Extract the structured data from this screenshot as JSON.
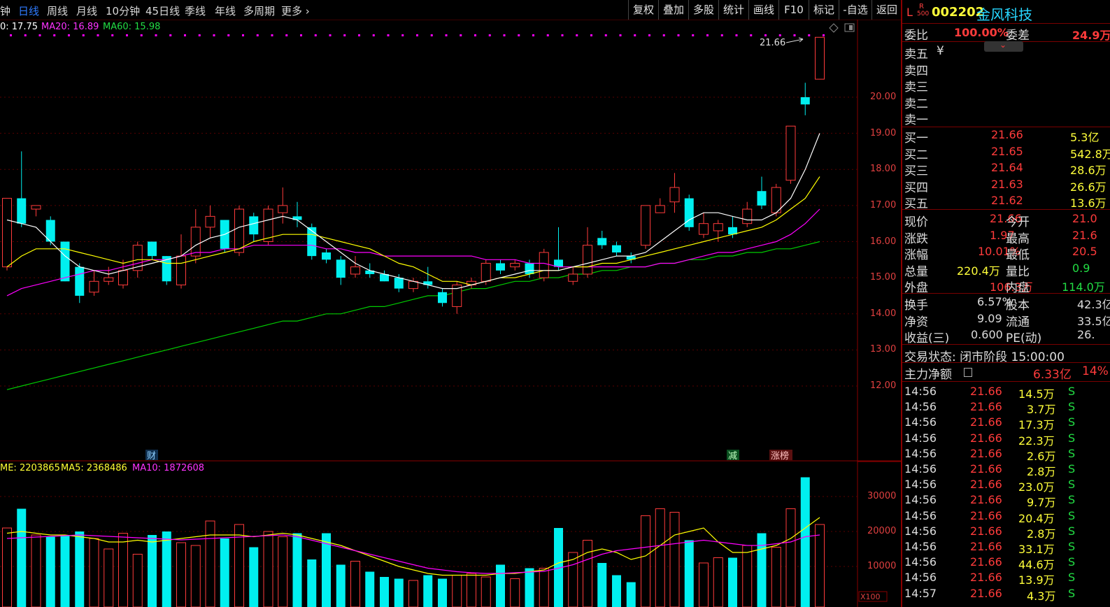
{
  "periods": [
    "钟",
    "日线",
    "周线",
    "月线",
    "10分钟",
    "45日线",
    "季线",
    "年线",
    "多周期",
    "更多"
  ],
  "active_period": "日线",
  "more_chevron": "›",
  "tools": [
    "复权",
    "叠加",
    "多股",
    "统计",
    "画线",
    "F10",
    "标记",
    "-自选",
    "返回"
  ],
  "ma_legend": {
    "ma10": "0: 17.75",
    "ma20": "MA20: 16.89",
    "ma60": "MA60: 15.98"
  },
  "vol_legend": {
    "vol": "ME: 2203865",
    "ma5": "MA5: 2368486",
    "ma10": "MA10: 1872608"
  },
  "price_ticks": [
    "20.00",
    "19.00",
    "18.00",
    "17.00",
    "16.00",
    "15.00",
    "14.00",
    "13.00",
    "12.00"
  ],
  "vol_ticks": [
    "30000",
    "20000",
    "10000"
  ],
  "vol_unit": "X100",
  "high_label": "21.66",
  "markers": {
    "cai": "财",
    "jian": "减",
    "zhangbang": "涨榜"
  },
  "colors": {
    "up": "#ff3b3b",
    "down": "#00f0f0",
    "ma10": "#ffffff",
    "ma20": "#ffff00",
    "ma60": "#ff00ff",
    "ma120": "#00cc00"
  },
  "stock": {
    "flag": "L",
    "r_top": "R",
    "r_bottom": "500",
    "code": "002202",
    "name": "金风科技"
  },
  "weibi": {
    "label": "委比",
    "value": "100.00%",
    "label2": "委差",
    "value2": "24.9万"
  },
  "sell": [
    {
      "label": "卖五",
      "extra": "¥"
    },
    {
      "label": "卖四",
      "extra": ""
    },
    {
      "label": "卖三",
      "extra": ""
    },
    {
      "label": "卖二",
      "extra": ""
    },
    {
      "label": "卖一",
      "extra": ""
    }
  ],
  "buy": [
    {
      "label": "买一",
      "price": "21.66",
      "vol": "5.3亿"
    },
    {
      "label": "买二",
      "price": "21.65",
      "vol": "542.8万"
    },
    {
      "label": "买三",
      "price": "21.64",
      "vol": "28.6万"
    },
    {
      "label": "买四",
      "price": "21.63",
      "vol": "26.6万"
    },
    {
      "label": "买五",
      "price": "21.62",
      "vol": "13.6万"
    }
  ],
  "quote": [
    {
      "l1": "现价",
      "v1": "21.66",
      "l2": "今开",
      "v2": "21.0"
    },
    {
      "l1": "涨跌",
      "v1": "1.97",
      "l2": "最高",
      "v2": "21.6"
    },
    {
      "l1": "涨幅",
      "v1": "10.01%",
      "l2": "最低",
      "v2": "20.5"
    },
    {
      "l1": "总量",
      "v1": "220.4万",
      "l2": "量比",
      "v2": "0.9"
    },
    {
      "l1": "外盘",
      "v1": "106.3万",
      "l2": "内盘",
      "v2": "114.0万"
    }
  ],
  "info": [
    {
      "l1": "换手",
      "v1": "6.57%",
      "l2": "股本",
      "v2": "42.3亿"
    },
    {
      "l1": "净资",
      "v1": "9.09",
      "l2": "流通",
      "v2": "33.5亿"
    },
    {
      "l1": "收益(三)",
      "v1": "0.600",
      "l2": "PE(动)",
      "v2": "26."
    }
  ],
  "trade_status": "交易状态: 闭市阶段 15:00:00",
  "main_force": {
    "label": "主力净额",
    "value": "6.33亿",
    "pct": "14%"
  },
  "ticks": [
    {
      "time": "14:56",
      "price": "21.66",
      "vol": "14.5万",
      "side": "S"
    },
    {
      "time": "14:56",
      "price": "21.66",
      "vol": "3.7万",
      "side": "S"
    },
    {
      "time": "14:56",
      "price": "21.66",
      "vol": "17.3万",
      "side": "S"
    },
    {
      "time": "14:56",
      "price": "21.66",
      "vol": "22.3万",
      "side": "S"
    },
    {
      "time": "14:56",
      "price": "21.66",
      "vol": "2.6万",
      "side": "S"
    },
    {
      "time": "14:56",
      "price": "21.66",
      "vol": "2.8万",
      "side": "S"
    },
    {
      "time": "14:56",
      "price": "21.66",
      "vol": "23.0万",
      "side": "S"
    },
    {
      "time": "14:56",
      "price": "21.66",
      "vol": "9.7万",
      "side": "S"
    },
    {
      "time": "14:56",
      "price": "21.66",
      "vol": "20.4万",
      "side": "S"
    },
    {
      "time": "14:56",
      "price": "21.66",
      "vol": "2.8万",
      "side": "S"
    },
    {
      "time": "14:56",
      "price": "21.66",
      "vol": "33.1万",
      "side": "S"
    },
    {
      "time": "14:56",
      "price": "21.66",
      "vol": "44.6万",
      "side": "S"
    },
    {
      "time": "14:56",
      "price": "21.66",
      "vol": "13.9万",
      "side": "S"
    },
    {
      "time": "14:57",
      "price": "21.66",
      "vol": "4.3万",
      "side": "S"
    }
  ],
  "chart_data": {
    "type": "candlestick",
    "price_axis": [
      12,
      20
    ],
    "candles": [
      {
        "o": 15.3,
        "c": 17.2,
        "h": 17.2,
        "l": 15.2
      },
      {
        "o": 17.2,
        "c": 16.5,
        "h": 18.5,
        "l": 16.4
      },
      {
        "o": 16.9,
        "c": 17.0,
        "h": 17.0,
        "l": 16.7
      },
      {
        "o": 16.6,
        "c": 16.0,
        "h": 16.7,
        "l": 15.9
      },
      {
        "o": 16.0,
        "c": 14.9,
        "h": 16.0,
        "l": 14.9
      },
      {
        "o": 15.3,
        "c": 14.5,
        "h": 15.4,
        "l": 14.3
      },
      {
        "o": 14.6,
        "c": 14.9,
        "h": 15.2,
        "l": 14.5
      },
      {
        "o": 14.9,
        "c": 15.0,
        "h": 15.3,
        "l": 14.8
      },
      {
        "o": 14.8,
        "c": 15.2,
        "h": 15.5,
        "l": 14.7
      },
      {
        "o": 15.2,
        "c": 15.9,
        "h": 16.0,
        "l": 15.0
      },
      {
        "o": 16.0,
        "c": 15.6,
        "h": 16.0,
        "l": 15.5
      },
      {
        "o": 15.6,
        "c": 14.9,
        "h": 15.6,
        "l": 14.8
      },
      {
        "o": 14.8,
        "c": 15.6,
        "h": 16.2,
        "l": 14.7
      },
      {
        "o": 15.6,
        "c": 16.4,
        "h": 16.9,
        "l": 15.4
      },
      {
        "o": 16.4,
        "c": 16.7,
        "h": 17.0,
        "l": 16.1
      },
      {
        "o": 16.6,
        "c": 15.8,
        "h": 16.6,
        "l": 15.7
      },
      {
        "o": 15.7,
        "c": 16.9,
        "h": 17.0,
        "l": 15.6
      },
      {
        "o": 16.7,
        "c": 16.2,
        "h": 16.8,
        "l": 16.0
      },
      {
        "o": 16.0,
        "c": 16.9,
        "h": 17.0,
        "l": 15.9
      },
      {
        "o": 16.8,
        "c": 17.0,
        "h": 17.5,
        "l": 16.5
      },
      {
        "o": 16.7,
        "c": 16.6,
        "h": 17.1,
        "l": 16.4
      },
      {
        "o": 16.4,
        "c": 15.6,
        "h": 16.5,
        "l": 15.5
      },
      {
        "o": 15.7,
        "c": 15.5,
        "h": 15.8,
        "l": 15.4
      },
      {
        "o": 15.5,
        "c": 15.0,
        "h": 15.6,
        "l": 14.8
      },
      {
        "o": 15.1,
        "c": 15.3,
        "h": 15.6,
        "l": 15.0
      },
      {
        "o": 15.2,
        "c": 15.1,
        "h": 15.4,
        "l": 15.0
      },
      {
        "o": 15.1,
        "c": 14.9,
        "h": 15.2,
        "l": 14.9
      },
      {
        "o": 15.0,
        "c": 14.7,
        "h": 15.1,
        "l": 14.6
      },
      {
        "o": 14.7,
        "c": 14.9,
        "h": 15.0,
        "l": 14.6
      },
      {
        "o": 14.9,
        "c": 14.8,
        "h": 15.3,
        "l": 14.7
      },
      {
        "o": 14.6,
        "c": 14.3,
        "h": 14.7,
        "l": 14.2
      },
      {
        "o": 14.2,
        "c": 14.8,
        "h": 14.9,
        "l": 14.0
      },
      {
        "o": 14.8,
        "c": 14.9,
        "h": 15.0,
        "l": 14.7
      },
      {
        "o": 14.9,
        "c": 15.4,
        "h": 15.5,
        "l": 14.8
      },
      {
        "o": 15.4,
        "c": 15.2,
        "h": 15.5,
        "l": 15.1
      },
      {
        "o": 15.3,
        "c": 15.4,
        "h": 15.5,
        "l": 15.2
      },
      {
        "o": 15.4,
        "c": 15.1,
        "h": 15.5,
        "l": 15.0
      },
      {
        "o": 15.0,
        "c": 15.7,
        "h": 15.8,
        "l": 14.9
      },
      {
        "o": 15.5,
        "c": 15.3,
        "h": 16.4,
        "l": 15.2
      },
      {
        "o": 14.9,
        "c": 15.1,
        "h": 15.3,
        "l": 14.8
      },
      {
        "o": 15.1,
        "c": 15.9,
        "h": 16.4,
        "l": 15.0
      },
      {
        "o": 16.1,
        "c": 15.9,
        "h": 16.3,
        "l": 15.8
      },
      {
        "o": 15.9,
        "c": 15.7,
        "h": 16.0,
        "l": 15.6
      },
      {
        "o": 15.6,
        "c": 15.5,
        "h": 15.7,
        "l": 15.4
      },
      {
        "o": 15.9,
        "c": 17.0,
        "h": 17.0,
        "l": 15.8
      },
      {
        "o": 16.8,
        "c": 17.0,
        "h": 17.2,
        "l": 16.8
      },
      {
        "o": 17.1,
        "c": 17.5,
        "h": 17.9,
        "l": 16.8
      },
      {
        "o": 17.2,
        "c": 16.4,
        "h": 17.3,
        "l": 16.3
      },
      {
        "o": 16.2,
        "c": 16.5,
        "h": 16.8,
        "l": 16.1
      },
      {
        "o": 16.3,
        "c": 16.5,
        "h": 16.6,
        "l": 16.0
      },
      {
        "o": 16.4,
        "c": 16.2,
        "h": 16.7,
        "l": 16.1
      },
      {
        "o": 16.5,
        "c": 16.9,
        "h": 17.1,
        "l": 16.4
      },
      {
        "o": 17.4,
        "c": 17.0,
        "h": 17.8,
        "l": 16.9
      },
      {
        "o": 16.8,
        "c": 17.5,
        "h": 17.6,
        "l": 16.7
      },
      {
        "o": 17.7,
        "c": 19.2,
        "h": 19.2,
        "l": 17.6
      },
      {
        "o": 20.0,
        "c": 19.8,
        "h": 20.4,
        "l": 19.5
      },
      {
        "o": 20.5,
        "c": 21.66,
        "h": 21.66,
        "l": 20.5
      }
    ],
    "ma_lines": {
      "ma10": [
        16.6,
        16.5,
        16.4,
        16.0,
        15.6,
        15.3,
        15.2,
        15.1,
        15.2,
        15.3,
        15.4,
        15.5,
        15.6,
        15.9,
        16.1,
        16.2,
        16.4,
        16.5,
        16.6,
        16.7,
        16.6,
        16.3,
        16.0,
        15.7,
        15.4,
        15.2,
        15.1,
        15.0,
        14.9,
        14.8,
        14.7,
        14.7,
        14.8,
        14.9,
        15.0,
        15.1,
        15.2,
        15.2,
        15.2,
        15.3,
        15.4,
        15.5,
        15.6,
        15.6,
        15.7,
        16.0,
        16.3,
        16.6,
        16.8,
        16.8,
        16.7,
        16.6,
        16.6,
        16.8,
        17.2,
        18.0,
        19.0
      ],
      "ma20": [
        15.3,
        15.6,
        15.8,
        15.8,
        15.8,
        15.7,
        15.6,
        15.5,
        15.4,
        15.5,
        15.5,
        15.4,
        15.4,
        15.5,
        15.6,
        15.7,
        15.8,
        16.0,
        16.1,
        16.2,
        16.2,
        16.2,
        16.1,
        16.0,
        15.9,
        15.8,
        15.6,
        15.4,
        15.3,
        15.1,
        14.9,
        14.9,
        14.8,
        14.9,
        15.0,
        15.0,
        15.1,
        15.2,
        15.2,
        15.3,
        15.3,
        15.4,
        15.4,
        15.5,
        15.6,
        15.7,
        15.8,
        15.9,
        16.0,
        16.1,
        16.2,
        16.3,
        16.4,
        16.6,
        16.9,
        17.2,
        17.8
      ],
      "ma60": [
        14.5,
        14.7,
        14.8,
        14.9,
        15.0,
        15.1,
        15.2,
        15.2,
        15.3,
        15.4,
        15.5,
        15.5,
        15.6,
        15.7,
        15.7,
        15.8,
        15.8,
        15.9,
        15.9,
        15.9,
        15.9,
        15.9,
        15.8,
        15.8,
        15.7,
        15.7,
        15.6,
        15.6,
        15.6,
        15.6,
        15.6,
        15.6,
        15.6,
        15.5,
        15.5,
        15.5,
        15.4,
        15.4,
        15.3,
        15.3,
        15.3,
        15.3,
        15.3,
        15.3,
        15.3,
        15.4,
        15.4,
        15.5,
        15.6,
        15.7,
        15.7,
        15.8,
        15.9,
        16.0,
        16.2,
        16.5,
        16.9
      ],
      "ma120": [
        11.9,
        12.0,
        12.1,
        12.2,
        12.3,
        12.4,
        12.5,
        12.6,
        12.7,
        12.8,
        12.9,
        13.0,
        13.1,
        13.2,
        13.3,
        13.4,
        13.5,
        13.6,
        13.7,
        13.8,
        13.8,
        13.9,
        14.0,
        14.0,
        14.1,
        14.2,
        14.2,
        14.3,
        14.4,
        14.5,
        14.5,
        14.6,
        14.7,
        14.7,
        14.8,
        14.9,
        14.9,
        15.0,
        15.0,
        15.1,
        15.1,
        15.2,
        15.2,
        15.3,
        15.3,
        15.4,
        15.4,
        15.5,
        15.5,
        15.6,
        15.6,
        15.7,
        15.7,
        15.8,
        15.8,
        15.9,
        16.0
      ]
    },
    "volume_axis": [
      0,
      36000
    ],
    "volumes": [
      21000,
      26500,
      19000,
      18500,
      19000,
      20000,
      18000,
      15000,
      19500,
      13500,
      19000,
      20000,
      16800,
      16000,
      23000,
      18000,
      22000,
      15500,
      20000,
      18500,
      19500,
      12000,
      19500,
      10500,
      11500,
      8500,
      7000,
      6500,
      6000,
      7500,
      6500,
      7500,
      8000,
      7000,
      10500,
      6500,
      9500,
      9500,
      21000,
      14000,
      17500,
      11000,
      7500,
      5500,
      24500,
      26500,
      25500,
      17500,
      11000,
      12500,
      12500,
      16000,
      19500,
      15500,
      26500,
      35500,
      22000
    ],
    "vol_ma5": [
      19500,
      20000,
      19500,
      19000,
      19000,
      18500,
      18000,
      17000,
      17000,
      17500,
      17000,
      17500,
      18000,
      18500,
      19000,
      19000,
      19000,
      18500,
      19000,
      19500,
      19000,
      18000,
      17000,
      16000,
      14500,
      13000,
      11500,
      10000,
      9000,
      8000,
      7500,
      7500,
      7500,
      7500,
      8000,
      8000,
      8500,
      9000,
      11000,
      12000,
      14000,
      15000,
      14000,
      12000,
      13000,
      16000,
      19000,
      20000,
      21000,
      17000,
      14000,
      14000,
      15000,
      16000,
      18000,
      21000,
      24000
    ],
    "vol_ma10": [
      18000,
      18200,
      18400,
      18600,
      18800,
      19000,
      18800,
      18600,
      18400,
      18200,
      18000,
      17800,
      17600,
      17800,
      18000,
      18200,
      18400,
      18600,
      18800,
      19000,
      18500,
      17500,
      16500,
      15500,
      14500,
      13500,
      12500,
      11500,
      10500,
      9500,
      9000,
      8500,
      8200,
      8000,
      8000,
      8200,
      8400,
      8600,
      9500,
      10500,
      12000,
      13500,
      14500,
      15000,
      15500,
      16000,
      16500,
      17000,
      17500,
      17000,
      16500,
      16000,
      16000,
      16500,
      17000,
      18500,
      19000
    ]
  }
}
